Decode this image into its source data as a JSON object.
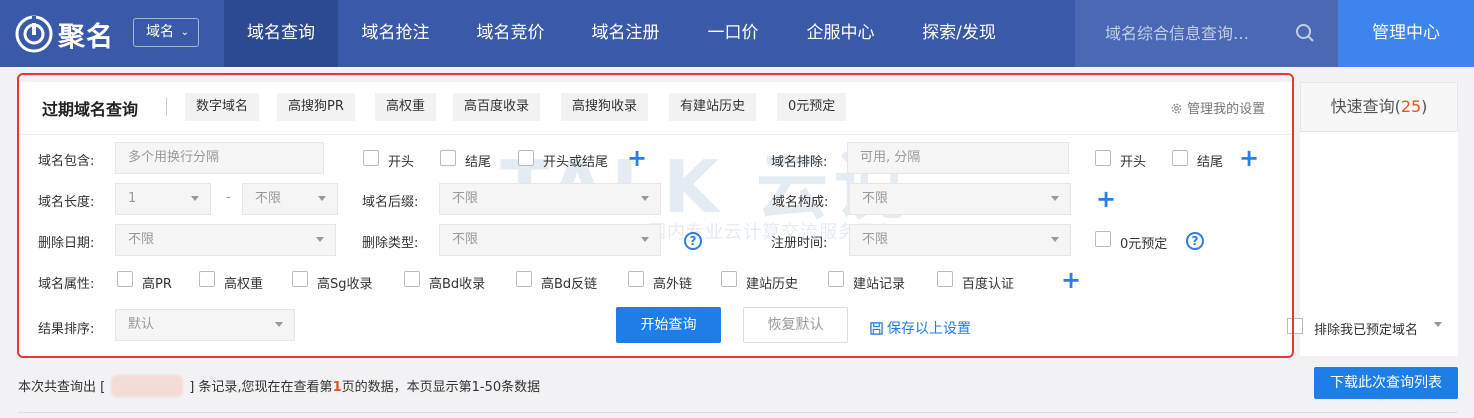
{
  "nav": {
    "logo_text": "聚名",
    "domain_select": "域名",
    "items": [
      "域名查询",
      "域名抢注",
      "域名竞价",
      "域名注册",
      "一口价",
      "企服中心",
      "探索/发现"
    ],
    "search_placeholder": "域名综合信息查询…",
    "manage_label": "管理中心"
  },
  "panel": {
    "title": "过期域名查询",
    "tags": [
      "数字域名",
      "高搜狗PR",
      "高权重",
      "高百度收录",
      "高搜狗收录",
      "有建站历史",
      "0元预定"
    ],
    "settings_label": "管理我的设置"
  },
  "quick_query": {
    "label": "快速查询(",
    "count": "25",
    "close": ")"
  },
  "form": {
    "contains_label": "域名包含:",
    "contains_placeholder": "多个用换行分隔",
    "opt_start": "开头",
    "opt_end": "结尾",
    "opt_start_or_end": "开头或结尾",
    "exclude_label": "域名排除:",
    "exclude_placeholder": "可用, 分隔",
    "length_label": "域名长度:",
    "length_min": "1",
    "length_max": "不限",
    "suffix_label": "域名后缀:",
    "suffix_value": "不限",
    "compose_label": "域名构成:",
    "compose_value": "不限",
    "delete_date_label": "删除日期:",
    "delete_date_value": "不限",
    "delete_type_label": "删除类型:",
    "delete_type_value": "不限",
    "reg_time_label": "注册时间:",
    "reg_time_value": "不限",
    "zero_reserve": "0元预定",
    "attr_label": "域名属性:",
    "attrs": [
      "高PR",
      "高权重",
      "高Sg收录",
      "高Bd收录",
      "高Bd反链",
      "高外链",
      "建站历史",
      "建站记录",
      "百度认证"
    ],
    "sort_label": "结果排序:",
    "sort_value": "默认",
    "search_btn": "开始查询",
    "reset_btn": "恢复默认",
    "save_link": "保存以上设置",
    "exclude_reserved": "排除我已预定域名"
  },
  "results": {
    "prefix": "本次共查询出 [",
    "middle": "] 条记录,您现在在查看第",
    "page": "1",
    "suffix": "页的数据，本页显示第1-50条数据",
    "download_btn": "下载此次查询列表"
  },
  "watermark": {
    "big": "TALK 云说",
    "small": "www.idctalk.com - 国内专业云计算交流服务平台-"
  },
  "colors": {
    "nav_bg": "#3a5aa9",
    "accent": "#1e7ee8",
    "highlight_border": "#e53935"
  }
}
